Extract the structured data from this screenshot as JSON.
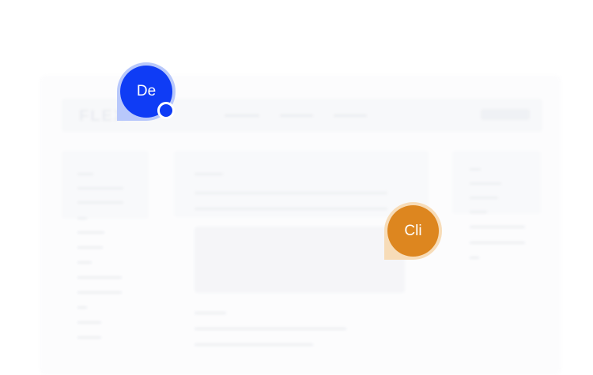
{
  "mockup": {
    "logo_text": "FLEX"
  },
  "avatars": [
    {
      "initials": "De",
      "color": "#0f3cf5",
      "ring_color": "#b8c8fb",
      "status": "online-dot"
    },
    {
      "initials": "Cli",
      "color": "#dd861f",
      "ring_color": "#f7dcb8"
    }
  ]
}
